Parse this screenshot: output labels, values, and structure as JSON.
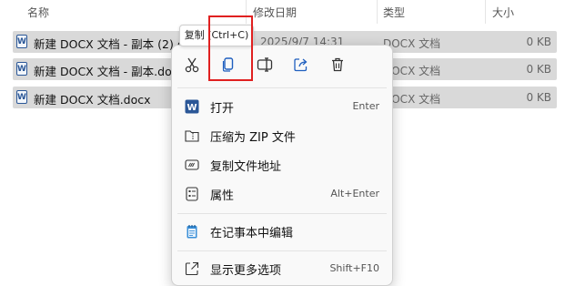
{
  "header": {
    "name_col": "名称",
    "date_col": "修改日期",
    "type_col": "类型",
    "size_col": "大小"
  },
  "files": [
    {
      "name": "新建 DOCX 文档 - 副本 (2).docx",
      "date": "2025/9/7 14:31",
      "type": "DOCX 文档",
      "size": "0 KB"
    },
    {
      "name": "新建 DOCX 文档 - 副本.docx",
      "date": "",
      "type": "DOCX 文档",
      "size": "0 KB"
    },
    {
      "name": "新建 DOCX 文档.docx",
      "date": "",
      "type": "DOCX 文档",
      "size": "0 KB"
    }
  ],
  "tooltip": "复制 (Ctrl+C)",
  "quick_actions": [
    "cut-icon",
    "copy-icon",
    "rename-icon",
    "share-icon",
    "delete-icon"
  ],
  "menu": {
    "open": {
      "label": "打开",
      "shortcut": "Enter"
    },
    "compress": {
      "label": "压缩为 ZIP 文件"
    },
    "copy_path": {
      "label": "复制文件地址"
    },
    "properties": {
      "label": "属性",
      "shortcut": "Alt+Enter"
    },
    "notepad": {
      "label": "在记事本中编辑"
    },
    "more": {
      "label": "显示更多选项",
      "shortcut": "Shift+F10"
    }
  },
  "colors": {
    "selection": "#d9d9d9",
    "highlight_box": "#e02020",
    "word_blue": "#2b5797"
  }
}
